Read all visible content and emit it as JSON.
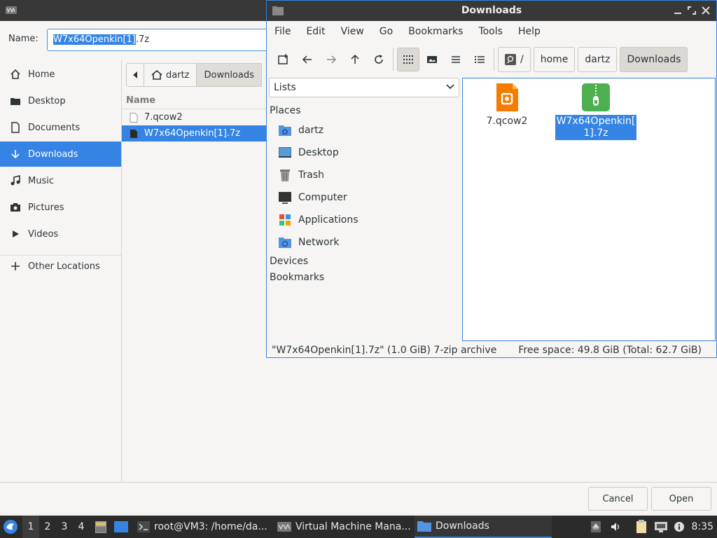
{
  "chooser": {
    "name_label": "Name:",
    "name_selected": "W7x64Openkin[1]",
    "name_rest": ".7z",
    "places": [
      {
        "label": "Home",
        "icon": "home-icon"
      },
      {
        "label": "Desktop",
        "icon": "desktop-icon"
      },
      {
        "label": "Documents",
        "icon": "documents-icon"
      },
      {
        "label": "Downloads",
        "icon": "downloads-icon",
        "active": true
      },
      {
        "label": "Music",
        "icon": "music-icon"
      },
      {
        "label": "Pictures",
        "icon": "pictures-icon"
      },
      {
        "label": "Videos",
        "icon": "videos-icon"
      },
      {
        "label": "Other Locations",
        "icon": "plus-icon"
      }
    ],
    "path": [
      "dartz",
      "Downloads"
    ],
    "column_name": "Name",
    "files": [
      {
        "name": "7.qcow2",
        "selected": false
      },
      {
        "name": "W7x64Openkin[1].7z",
        "selected": true
      }
    ],
    "cancel_label": "Cancel",
    "open_label": "Open"
  },
  "fm": {
    "title": "Downloads",
    "menu": [
      "File",
      "Edit",
      "View",
      "Go",
      "Bookmarks",
      "Tools",
      "Help"
    ],
    "path": [
      "/",
      "home",
      "dartz",
      "Downloads"
    ],
    "side_mode": "Lists",
    "places_header": "Places",
    "places": [
      {
        "label": "dartz",
        "icon": "home-folder-icon"
      },
      {
        "label": "Desktop",
        "icon": "desktop-icon"
      },
      {
        "label": "Trash",
        "icon": "trash-icon"
      },
      {
        "label": "Computer",
        "icon": "computer-icon"
      },
      {
        "label": "Applications",
        "icon": "applications-icon"
      },
      {
        "label": "Network",
        "icon": "network-icon"
      }
    ],
    "devices_header": "Devices",
    "bookmarks_header": "Bookmarks",
    "items": [
      {
        "name": "7.qcow2",
        "icon": "disk-image-icon",
        "selected": false
      },
      {
        "name_line1": "W7x64Openkin[",
        "name_line2": "1].7z",
        "icon": "archive-icon",
        "selected": true
      }
    ],
    "status_left": "\"W7x64Openkin[1].7z\" (1.0 GiB) 7-zip archive",
    "status_right": "Free space: 49.8 GiB (Total: 62.7 GiB)"
  },
  "taskbar": {
    "workspaces": [
      "1",
      "2",
      "3",
      "4"
    ],
    "tasks": [
      {
        "label": "root@VM3: /home/da...",
        "icon": "terminal-icon"
      },
      {
        "label": "Virtual Machine Mana...",
        "icon": "virt-manager-icon"
      },
      {
        "label": "Downloads",
        "icon": "folder-icon",
        "active": true
      }
    ],
    "clock": "8:35"
  },
  "colors": {
    "accent": "#3584e4",
    "titlebar": "#383838",
    "panel": "#2b2b2b"
  }
}
